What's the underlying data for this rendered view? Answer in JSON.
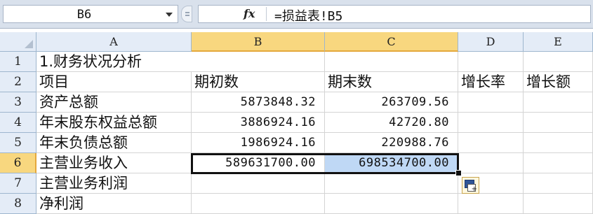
{
  "formula_bar": {
    "name_box": "B6",
    "fx_label": "fx",
    "formula": "=损益表!B5"
  },
  "columns": [
    "A",
    "B",
    "C",
    "D",
    "E"
  ],
  "rows": [
    {
      "num": "1",
      "a": "1.财务状况分析",
      "b": "",
      "c": "",
      "d": "",
      "e": ""
    },
    {
      "num": "2",
      "a": "项目",
      "b": "期初数",
      "c": "期末数",
      "d": "增长率",
      "e": "增长额"
    },
    {
      "num": "3",
      "a": "资产总额",
      "b": "5873848.32",
      "c": "263709.56",
      "d": "",
      "e": ""
    },
    {
      "num": "4",
      "a": "年末股东权益总额",
      "b": "3886924.16",
      "c": "42720.80",
      "d": "",
      "e": ""
    },
    {
      "num": "5",
      "a": "年末负债总额",
      "b": "1986924.16",
      "c": "220988.76",
      "d": "",
      "e": ""
    },
    {
      "num": "6",
      "a": "主营业务收入",
      "b": "589631700.00",
      "c": "698534700.00",
      "d": "",
      "e": ""
    },
    {
      "num": "7",
      "a": "主营业务利润",
      "b": "",
      "c": "",
      "d": "",
      "e": ""
    },
    {
      "num": "8",
      "a": "净利润",
      "b": "",
      "c": "",
      "d": "",
      "e": ""
    }
  ],
  "selection": {
    "active_cell": "B6",
    "range": "B6:C6"
  },
  "colors": {
    "header_bg": "#e4ecf7",
    "selected_header_bg": "#f8d77f",
    "highlight_cell": "#bfd8f5",
    "gridline": "#d4d4d4"
  },
  "icons": [
    "chevron-down-icon",
    "fx-icon",
    "paste-options-icon"
  ]
}
